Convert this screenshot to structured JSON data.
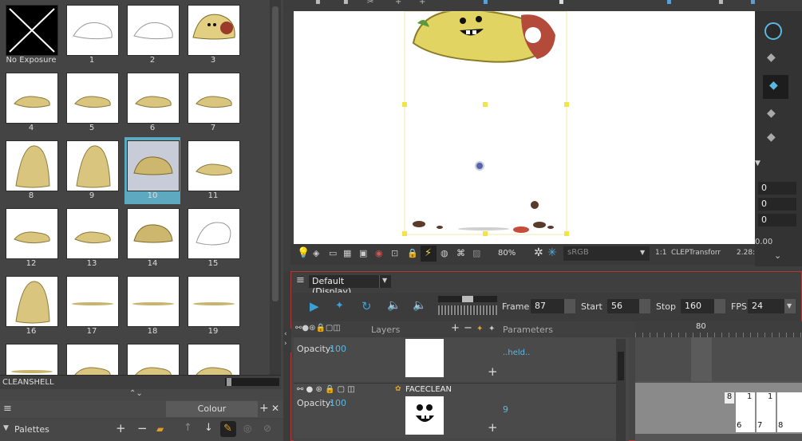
{
  "level_strip": {
    "cells": [
      {
        "label": "No Exposure",
        "kind": "noexp"
      },
      {
        "label": "1",
        "kind": "sketch"
      },
      {
        "label": "2",
        "kind": "sketch"
      },
      {
        "label": "3",
        "kind": "taco"
      },
      {
        "label": "4",
        "kind": "flat"
      },
      {
        "label": "5",
        "kind": "flat"
      },
      {
        "label": "6",
        "kind": "flat"
      },
      {
        "label": "7",
        "kind": "flat"
      },
      {
        "label": "8",
        "kind": "tall"
      },
      {
        "label": "9",
        "kind": "tall"
      },
      {
        "label": "10",
        "kind": "fold",
        "selected": true
      },
      {
        "label": "11",
        "kind": "flat"
      },
      {
        "label": "12",
        "kind": "flat"
      },
      {
        "label": "13",
        "kind": "flat"
      },
      {
        "label": "14",
        "kind": "fold"
      },
      {
        "label": "15",
        "kind": "outline"
      },
      {
        "label": "16",
        "kind": "tall"
      },
      {
        "label": "17",
        "kind": "line"
      },
      {
        "label": "18",
        "kind": "line"
      },
      {
        "label": "19",
        "kind": "line"
      },
      {
        "label": "",
        "kind": "line"
      },
      {
        "label": "",
        "kind": "flat"
      },
      {
        "label": "",
        "kind": "flat"
      },
      {
        "label": "",
        "kind": "flat"
      }
    ],
    "level_name": "CLEANSHELL"
  },
  "colour_panel": {
    "tab_label": "Colour",
    "palettes_label": "Palettes"
  },
  "viewer_toolbar": {
    "zoom": "80%",
    "color_space": "sRGB",
    "ratio": "1:1",
    "transform_label": "CLEPTransforr",
    "ratio2": "2.28:",
    "value_000": "0.00"
  },
  "right_tool_fields": [
    "0",
    "0",
    "0"
  ],
  "timeline": {
    "display_select": "Default (Display)",
    "frame_label": "Frame",
    "frame_value": "87",
    "start_label": "Start",
    "start_value": "56",
    "stop_label": "Stop",
    "stop_value": "160",
    "fps_label": "FPS",
    "fps_value": "24",
    "layers_header": "Layers",
    "parameters_header": "Parameters",
    "track_frame_marker": "80",
    "layer1": {
      "opacity_label": "Opacity:",
      "opacity_value": "100",
      "param": "..held.."
    },
    "layer2": {
      "name": "FACECLEAN",
      "opacity_label": "Opacity:",
      "opacity_value": "100",
      "param": "9"
    },
    "track_cells": [
      "8",
      "1",
      "1",
      "6",
      "7",
      "8"
    ]
  },
  "colors": {
    "accent_blue": "#3aa0d8",
    "selection_teal": "#5fa9c0",
    "border_red": "#b13636",
    "taco_yellow": "#e2cf82"
  }
}
